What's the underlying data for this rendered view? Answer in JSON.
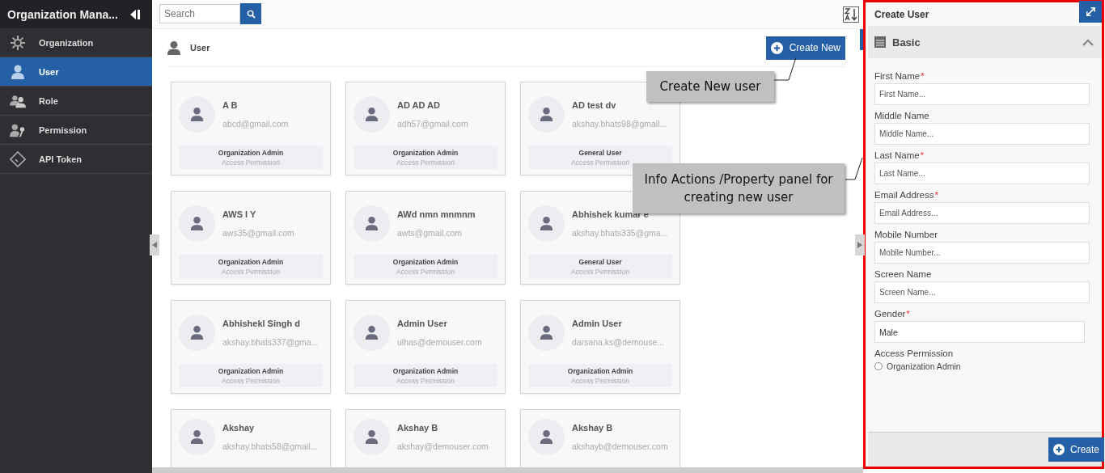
{
  "sidebar": {
    "title": "Organization Mana...",
    "items": [
      {
        "label": "Organization",
        "kind": "gear",
        "selected": false
      },
      {
        "label": "User",
        "kind": "person",
        "selected": true
      },
      {
        "label": "Role",
        "kind": "people",
        "selected": false
      },
      {
        "label": "Permission",
        "kind": "key",
        "selected": false
      },
      {
        "label": "API Token",
        "kind": "tag",
        "selected": false
      }
    ]
  },
  "search": {
    "placeholder": "Search"
  },
  "header": {
    "title": "User",
    "create_button": "Create New"
  },
  "users": [
    {
      "name": "A B",
      "email": "abcd@gmail.com",
      "role": "Organization Admin",
      "role_caption": "Access Permission"
    },
    {
      "name": "AD AD AD",
      "email": "adh57@gmail.com",
      "role": "Organization Admin",
      "role_caption": "Access Permission"
    },
    {
      "name": "AD test dv",
      "email": "akshay.bhats98@gmail...",
      "role": "General User",
      "role_caption": "Access Permission"
    },
    {
      "name": "AWS I Y",
      "email": "aws35@gmail.com",
      "role": "Organization Admin",
      "role_caption": "Access Permission"
    },
    {
      "name": "AWd nmn mnmnm",
      "email": "awts@gmail.com",
      "role": "Organization Admin",
      "role_caption": "Access Permission"
    },
    {
      "name": "Abhishek kumar e",
      "email": "akshay.bhats335@gma...",
      "role": "General User",
      "role_caption": "Access Permission"
    },
    {
      "name": "Abhishekl Singh d",
      "email": "akshay.bhats337@gma...",
      "role": "Organization Admin",
      "role_caption": "Access Permission"
    },
    {
      "name": "Admin User",
      "email": "ulhas@demouser.com",
      "role": "Organization Admin",
      "role_caption": "Access Permission"
    },
    {
      "name": "Admin User",
      "email": "darsana.ks@demouse...",
      "role": "Organization Admin",
      "role_caption": "Access Permission"
    },
    {
      "name": "Akshay",
      "email": "akshay.bhats58@gmail..."
    },
    {
      "name": "Akshay B",
      "email": "akshay@demouser.com"
    },
    {
      "name": "Akshay B",
      "email": "akshayb@demouser.com"
    }
  ],
  "panel": {
    "title": "Create User",
    "section": {
      "title": "Basic",
      "expanded": true
    },
    "fields": [
      {
        "kind": "text",
        "label": "First Name",
        "required_mark": "*",
        "placeholder": "First Name..."
      },
      {
        "kind": "text",
        "label": "Middle Name",
        "placeholder": "Middle Name..."
      },
      {
        "kind": "text",
        "label": "Last Name",
        "required_mark": "*",
        "placeholder": "Last Name..."
      },
      {
        "kind": "text",
        "label": "Email Address",
        "required_mark": "*",
        "placeholder": "Email Address..."
      },
      {
        "kind": "text",
        "label": "Mobile Number",
        "placeholder": "Mobile Number..."
      },
      {
        "kind": "text",
        "label": "Screen Name",
        "placeholder": "Screen Name..."
      },
      {
        "kind": "select",
        "label": "Gender",
        "required_mark": "*",
        "value": "Male"
      }
    ],
    "access": {
      "label": "Access Permission",
      "options": [
        {
          "label": "Organization Admin",
          "selected": false
        }
      ]
    },
    "submit": "Create"
  },
  "callouts": [
    {
      "text": "Create New user"
    },
    {
      "text": "Info Actions /Property panel for creating new user"
    }
  ]
}
